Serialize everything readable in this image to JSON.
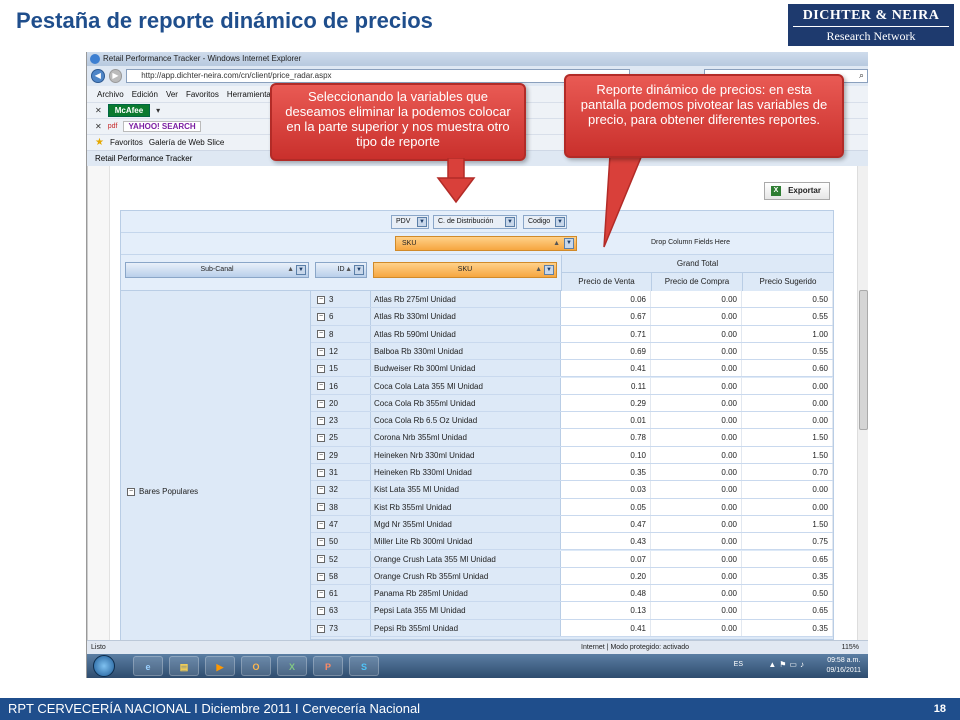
{
  "slide": {
    "title": "Pestaña de reporte dinámico de precios",
    "logo_line1": "DICHTER & NEIRA",
    "logo_line2": "Research Network",
    "footer_text": "RPT CERVECERÍA NACIONAL  I  Diciembre 2011  I  Cervecería Nacional",
    "page_number": "18"
  },
  "browser": {
    "window_title": "Retail Performance Tracker - Windows Internet Explorer",
    "url": "http://app.dichter-neira.com/cn/client/price_radar.aspx",
    "menu": [
      "Archivo",
      "Edición",
      "Ver",
      "Favoritos",
      "Herramientas"
    ],
    "mcafee_label": "McAfee",
    "yahoo_label": "YAHOO! SEARCH",
    "favorites_label": "Favoritos",
    "web_slice_label": "Galería de Web Slice",
    "tab_title": "Retail Performance Tracker",
    "status_left": "Listo",
    "status_mid": "Internet | Modo protegido: activado",
    "zoom": "115%",
    "tray_lang": "ES",
    "clock_time": "09:58 a.m.",
    "clock_date": "09/16/2011"
  },
  "pivot": {
    "export_label": "Exportar",
    "filter_fields": [
      "PDV",
      "C. de Distribución",
      "Codigo"
    ],
    "column_field": "SKU",
    "drop_hint": "Drop Column Fields Here",
    "row_fields": [
      "Sub-Canal",
      "ID",
      "SKU"
    ],
    "grand_total": "Grand Total",
    "measures": [
      "Precio de Venta",
      "Precio de Compra",
      "Precio Sugerido"
    ],
    "group_label": "Bares Populares",
    "rows": [
      {
        "id": "3",
        "sku": "Atlas Rb 275ml Unidad",
        "venta": "0.06",
        "compra": "0.00",
        "sugerido": "0.50"
      },
      {
        "id": "6",
        "sku": "Atlas Rb 330ml Unidad",
        "venta": "0.67",
        "compra": "0.00",
        "sugerido": "0.55"
      },
      {
        "id": "8",
        "sku": "Atlas Rb 590ml Unidad",
        "venta": "0.71",
        "compra": "0.00",
        "sugerido": "1.00"
      },
      {
        "id": "12",
        "sku": "Balboa Rb 330ml Unidad",
        "venta": "0.69",
        "compra": "0.00",
        "sugerido": "0.55"
      },
      {
        "id": "15",
        "sku": "Budweiser Rb 300ml Unidad",
        "venta": "0.41",
        "compra": "0.00",
        "sugerido": "0.60"
      },
      {
        "id": "16",
        "sku": "Coca Cola Lata 355 Ml Unidad",
        "venta": "0.11",
        "compra": "0.00",
        "sugerido": "0.00"
      },
      {
        "id": "20",
        "sku": "Coca Cola Rb 355ml Unidad",
        "venta": "0.29",
        "compra": "0.00",
        "sugerido": "0.00"
      },
      {
        "id": "23",
        "sku": "Coca Cola Rb 6.5 Oz Unidad",
        "venta": "0.01",
        "compra": "0.00",
        "sugerido": "0.00"
      },
      {
        "id": "25",
        "sku": "Corona Nrb 355ml Unidad",
        "venta": "0.78",
        "compra": "0.00",
        "sugerido": "1.50"
      },
      {
        "id": "29",
        "sku": "Heineken Nrb 330ml Unidad",
        "venta": "0.10",
        "compra": "0.00",
        "sugerido": "1.50"
      },
      {
        "id": "31",
        "sku": "Heineken Rb 330ml Unidad",
        "venta": "0.35",
        "compra": "0.00",
        "sugerido": "0.70"
      },
      {
        "id": "32",
        "sku": "Kist Lata 355 Ml Unidad",
        "venta": "0.03",
        "compra": "0.00",
        "sugerido": "0.00"
      },
      {
        "id": "38",
        "sku": "Kist Rb 355ml Unidad",
        "venta": "0.05",
        "compra": "0.00",
        "sugerido": "0.00"
      },
      {
        "id": "47",
        "sku": "Mgd Nr 355ml Unidad",
        "venta": "0.47",
        "compra": "0.00",
        "sugerido": "1.50"
      },
      {
        "id": "50",
        "sku": "Miller Lite Rb 300ml Unidad",
        "venta": "0.43",
        "compra": "0.00",
        "sugerido": "0.75"
      },
      {
        "id": "52",
        "sku": "Orange Crush Lata 355 Ml Unidad",
        "venta": "0.07",
        "compra": "0.00",
        "sugerido": "0.65"
      },
      {
        "id": "58",
        "sku": "Orange Crush Rb 355ml Unidad",
        "venta": "0.20",
        "compra": "0.00",
        "sugerido": "0.35"
      },
      {
        "id": "61",
        "sku": "Panama Rb 285ml Unidad",
        "venta": "0.48",
        "compra": "0.00",
        "sugerido": "0.50"
      },
      {
        "id": "63",
        "sku": "Pepsi Lata 355 Ml Unidad",
        "venta": "0.13",
        "compra": "0.00",
        "sugerido": "0.65"
      },
      {
        "id": "73",
        "sku": "Pepsi Rb 355ml Unidad",
        "venta": "0.41",
        "compra": "0.00",
        "sugerido": "0.35"
      }
    ]
  },
  "callouts": {
    "left": "Seleccionando la variables que deseamos eliminar la podemos colocar en la parte superior y nos muestra otro tipo de reporte",
    "right": "Reporte dinámico de precios:  en esta pantalla podemos pivotear las variables de precio, para obtener diferentes reportes."
  },
  "colors": {
    "title_blue": "#1f4e8c",
    "callout_red": "#d9403a",
    "sku_orange": "#f6a640"
  }
}
